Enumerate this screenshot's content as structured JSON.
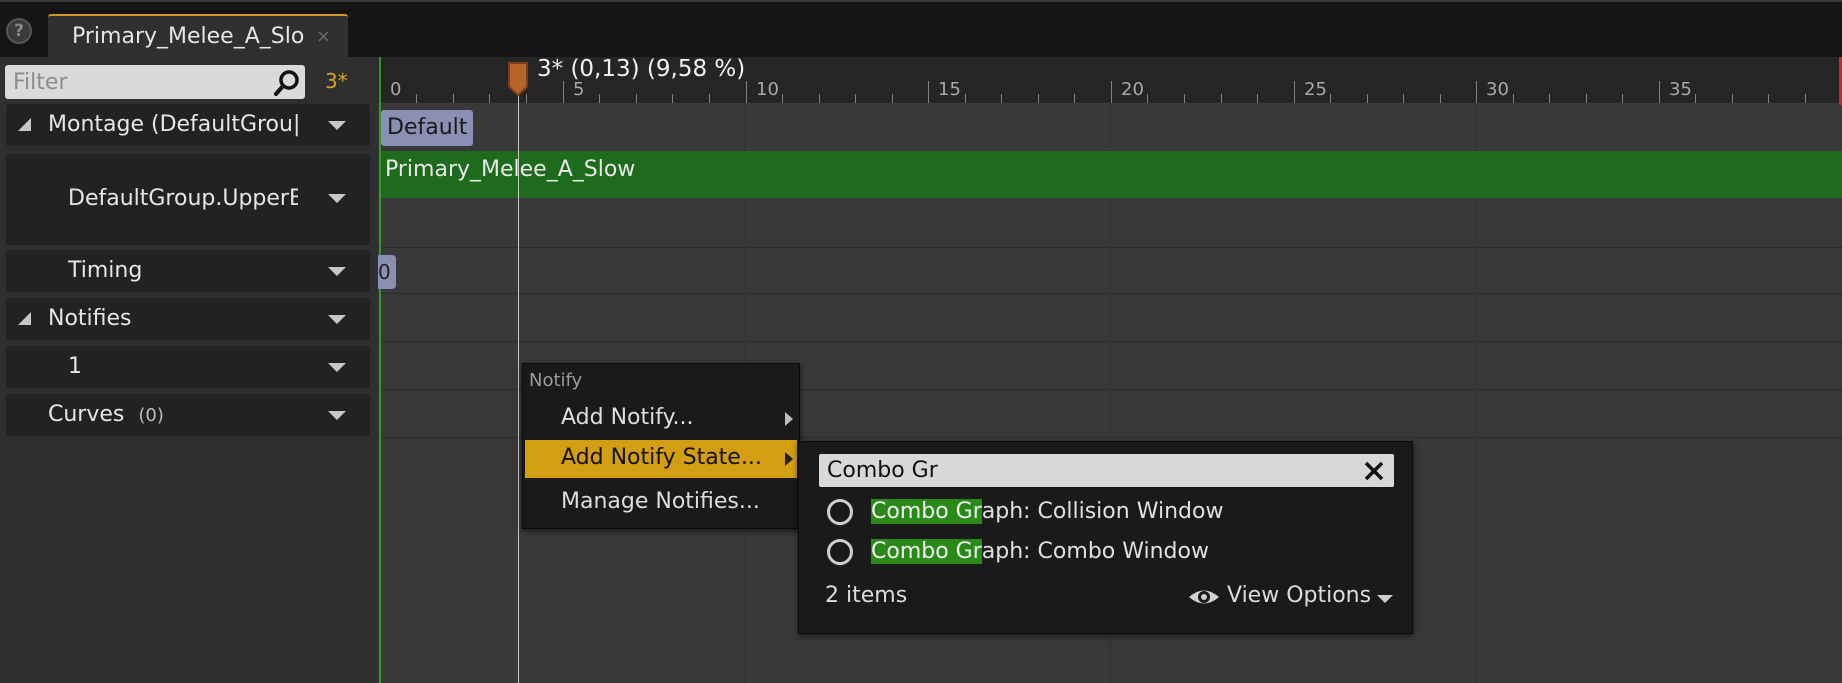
{
  "tab": {
    "title": "Primary_Melee_A_Slo",
    "close_glyph": "×"
  },
  "help_glyph": "?",
  "filter": {
    "placeholder": "Filter",
    "value": ""
  },
  "frame_counter": "3*",
  "tracks": [
    {
      "label": "Montage (DefaultGrou|",
      "count": ""
    },
    {
      "label": "DefaultGroup.UpperB",
      "count": ""
    },
    {
      "label": "Timing",
      "count": ""
    },
    {
      "label": "Notifies",
      "count": ""
    },
    {
      "label": "1",
      "count": ""
    },
    {
      "label": "Curves",
      "count": "(0)"
    }
  ],
  "timeline": {
    "playhead_readout": "3* (0,13) (9,58 %)",
    "ruler_labels": [
      "0",
      "5",
      "10",
      "15",
      "20",
      "25",
      "30",
      "35"
    ],
    "default_tag": "Default",
    "segment_label": "Primary_Melee_A_Slow",
    "timing_marker": "0"
  },
  "context_menu": {
    "header": "Notify",
    "items": [
      {
        "label": "Add Notify...",
        "submenu": true
      },
      {
        "label": "Add Notify State...",
        "submenu": true,
        "active": true
      },
      {
        "label": "Manage Notifies...",
        "submenu": false
      }
    ]
  },
  "submenu": {
    "search_value": "Combo Gr",
    "results": [
      {
        "match": "Combo Gr",
        "rest": "aph: Collision Window"
      },
      {
        "match": "Combo Gr",
        "rest": "aph: Combo Window"
      }
    ],
    "items_count": "2 items",
    "view_options_label": "View Options"
  },
  "colors": {
    "accent": "#d39e12",
    "segment_green": "#1e6b1e",
    "highlight_green": "#2a8a17",
    "playhead_orange": "#b5652a",
    "marker_purple": "#8b8fb3"
  },
  "icons": [
    "help-icon",
    "search-icon",
    "close-icon",
    "playhead-marker-icon",
    "eye-icon",
    "chevron-down-icon",
    "submenu-arrow-icon",
    "radio-icon"
  ]
}
